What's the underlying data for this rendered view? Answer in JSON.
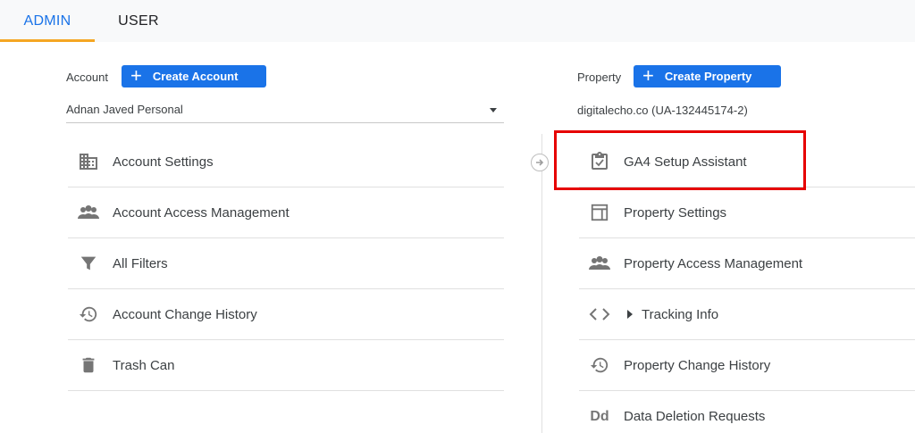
{
  "tabs": [
    {
      "label": "ADMIN",
      "active": true
    },
    {
      "label": "USER",
      "active": false
    }
  ],
  "account": {
    "label": "Account",
    "create_button": "Create Account",
    "plus_glyph": "+",
    "selected": "Adnan Javed Personal",
    "items": [
      {
        "label": "Account Settings",
        "icon": "building-icon"
      },
      {
        "label": "Account Access Management",
        "icon": "people-icon"
      },
      {
        "label": "All Filters",
        "icon": "filter-icon"
      },
      {
        "label": "Account Change History",
        "icon": "history-icon"
      },
      {
        "label": "Trash Can",
        "icon": "trash-icon"
      }
    ]
  },
  "property": {
    "label": "Property",
    "create_button": "Create Property",
    "plus_glyph": "+",
    "selected": "digitalecho.co (UA-132445174-2)",
    "items": [
      {
        "label": "GA4 Setup Assistant",
        "icon": "clipboard-check-icon",
        "highlighted": true
      },
      {
        "label": "Property Settings",
        "icon": "layout-icon"
      },
      {
        "label": "Property Access Management",
        "icon": "people-icon"
      },
      {
        "label": "Tracking Info",
        "icon": "code-icon",
        "expandable": true
      },
      {
        "label": "Property Change History",
        "icon": "history-icon"
      },
      {
        "label": "Data Deletion Requests",
        "icon": "dd-icon",
        "icon_text": "Dd"
      }
    ]
  },
  "colors": {
    "accent": "#1a73e8",
    "tab_underline": "#f5a623",
    "highlight": "#e60000"
  }
}
